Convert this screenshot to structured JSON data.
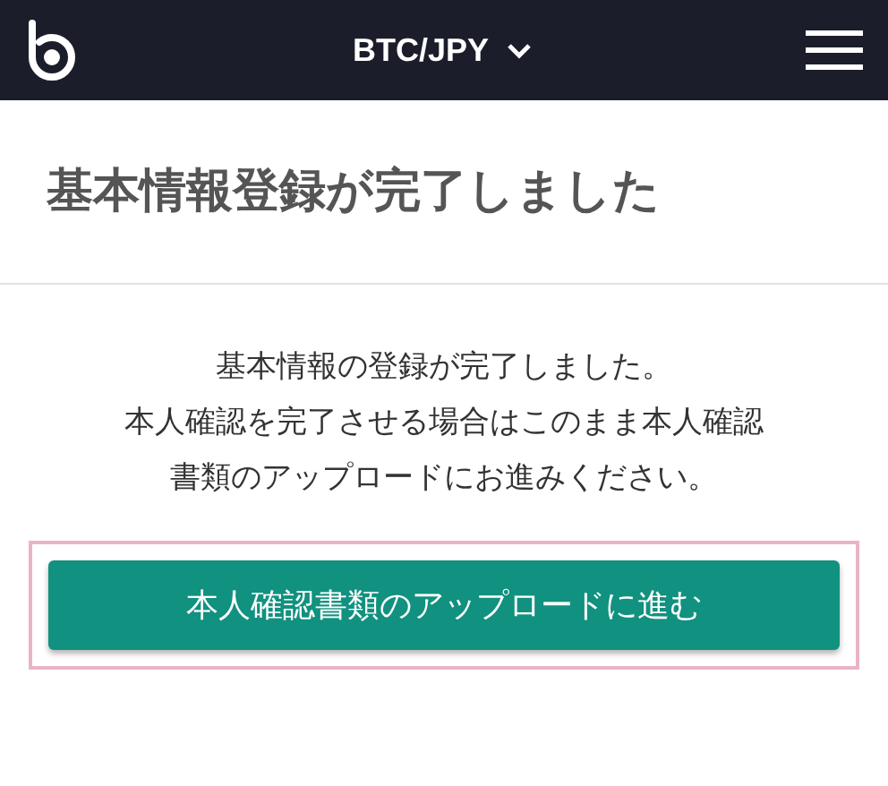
{
  "header": {
    "pair_selector": "BTC/JPY"
  },
  "title": "基本情報登録が完了しました",
  "message": [
    "基本情報の登録が完了しました。",
    "本人確認を完了させる場合はこのまま本人確認書類のアップロードにお進みください。"
  ],
  "action_button": {
    "label": "本人確認書類のアップロードに進む",
    "highlighted": true
  }
}
